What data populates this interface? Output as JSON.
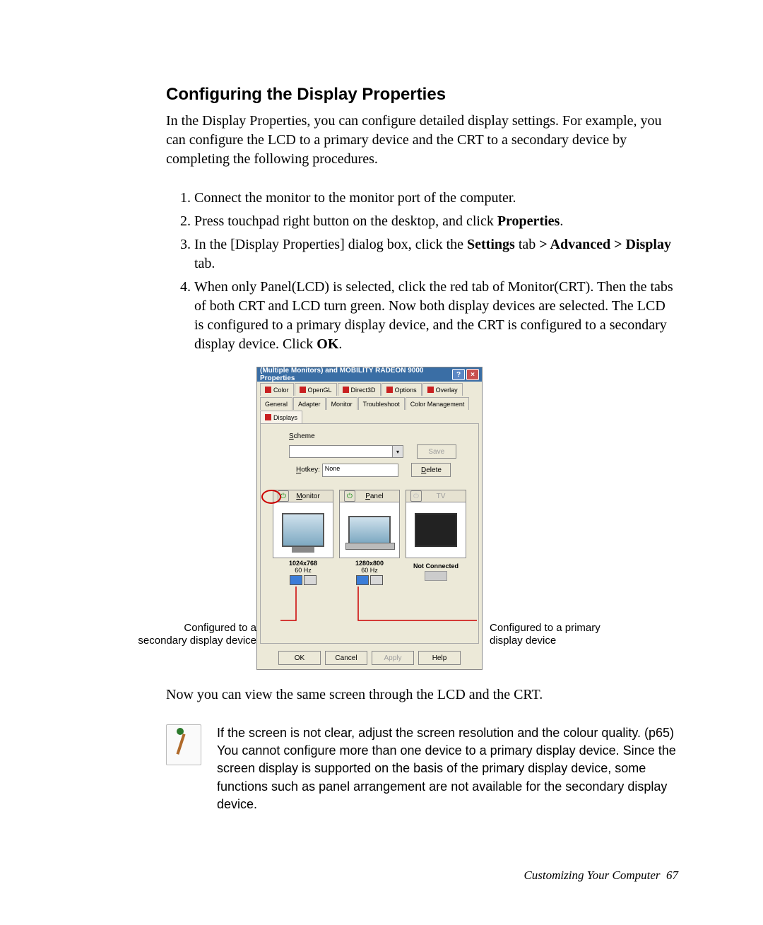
{
  "heading": "Configuring the Display Properties",
  "intro": "In the Display Properties, you can configure detailed display settings. For example, you can configure the LCD to a primary device and the CRT to a secondary device by completing the following procedures.",
  "steps": {
    "s1": "Connect the monitor to the monitor port of the computer.",
    "s2a": "Press touchpad right button on the desktop, and click ",
    "s2b": "Properties",
    "s2c": ".",
    "s3a": "In the [Display Properties] dialog box, click the ",
    "s3b": "Settings",
    "s3c": " tab ",
    "s3d": "> Advanced > Display",
    "s3e": " tab.",
    "s4a": "When only Panel(LCD) is selected, click the red tab of Monitor(CRT). Then the tabs of both CRT and LCD turn green. Now both display devices are selected. The LCD is configured to a primary display device, and the CRT is configured to a secondary display device. Click ",
    "s4b": "OK",
    "s4c": "."
  },
  "followup": "Now you can view the same screen through the LCD and the CRT.",
  "note1": "If the screen is not clear, adjust the screen resolution and the colour quality. (p65)",
  "note2": "You cannot configure more than one device to a primary display device. Since the screen display is supported on the basis of the primary display device, some functions such as panel arrangement are not available for the secondary display device.",
  "footer_label": "Customizing Your Computer",
  "footer_page": "67",
  "caption_left": "Configured to a secondary display device",
  "caption_right": "Configured to a primary display device",
  "win": {
    "title": "(Multiple Monitors) and MOBILITY RADEON 9000 Properties",
    "tabs_row1": [
      "Color",
      "OpenGL",
      "Direct3D",
      "Options",
      "Overlay"
    ],
    "tabs_row2": [
      "General",
      "Adapter",
      "Monitor",
      "Troubleshoot",
      "Color Management",
      "Displays"
    ],
    "scheme_label": "Scheme",
    "save": "Save",
    "delete": "Delete",
    "hotkey_label": "Hotkey:",
    "hotkey_value": "None",
    "dev_monitor": "Monitor",
    "dev_panel": "Panel",
    "dev_tv": "TV",
    "res_monitor": "1024x768",
    "hz_monitor": "60 Hz",
    "res_panel": "1280x800",
    "hz_panel": "60 Hz",
    "not_connected": "Not Connected",
    "btn_ok": "OK",
    "btn_cancel": "Cancel",
    "btn_apply": "Apply",
    "btn_help": "Help"
  }
}
